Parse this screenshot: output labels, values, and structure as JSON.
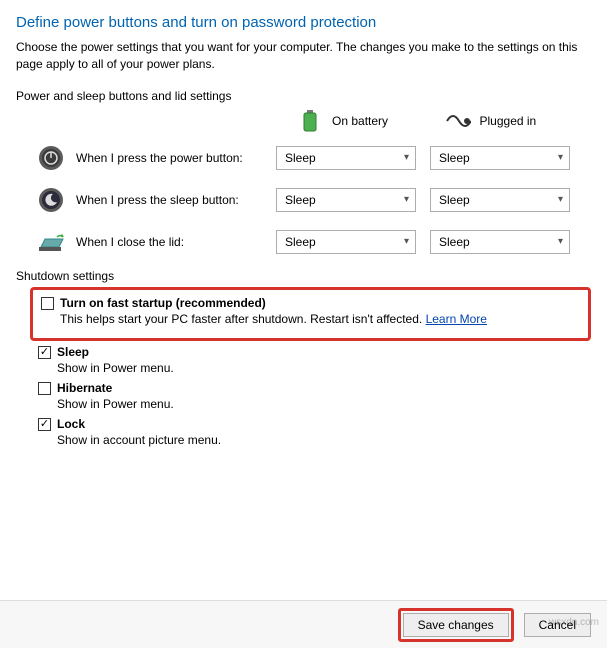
{
  "title": "Define power buttons and turn on password protection",
  "description": "Choose the power settings that you want for your computer. The changes you make to the settings on this page apply to all of your power plans.",
  "section_label": "Power and sleep buttons and lid settings",
  "columns": {
    "battery": "On battery",
    "plugged": "Plugged in"
  },
  "rows": {
    "power": {
      "label": "When I press the power button:",
      "battery": "Sleep",
      "plugged": "Sleep"
    },
    "sleep": {
      "label": "When I press the sleep button:",
      "battery": "Sleep",
      "plugged": "Sleep"
    },
    "lid": {
      "label": "When I close the lid:",
      "battery": "Sleep",
      "plugged": "Sleep"
    }
  },
  "shutdown": {
    "label": "Shutdown settings",
    "fast_startup": {
      "title": "Turn on fast startup (recommended)",
      "desc": "This helps start your PC faster after shutdown. Restart isn't affected.",
      "link": "Learn More"
    },
    "sleep": {
      "title": "Sleep",
      "desc": "Show in Power menu."
    },
    "hibernate": {
      "title": "Hibernate",
      "desc": "Show in Power menu."
    },
    "lock": {
      "title": "Lock",
      "desc": "Show in account picture menu."
    }
  },
  "buttons": {
    "save": "Save changes",
    "cancel": "Cancel"
  },
  "watermark": "wsxdn.com"
}
